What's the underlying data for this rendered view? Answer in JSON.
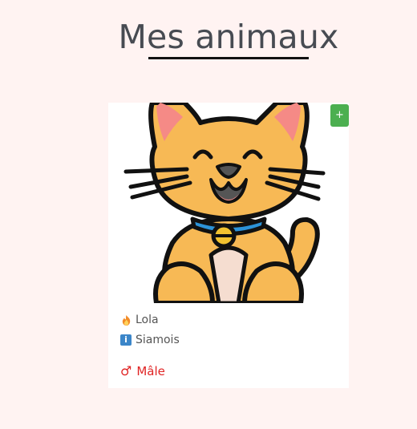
{
  "page": {
    "title": "Mes animaux"
  },
  "card": {
    "add_button_label": "+",
    "name": "Lola",
    "breed": "Siamois",
    "gender": "Mâle",
    "icons": {
      "name_icon": "fire-icon",
      "breed_icon": "info-icon",
      "gender_icon": "male-sign-icon",
      "image": "cat-illustration"
    },
    "info_glyph": "i",
    "gender_glyph": "♂"
  },
  "colors": {
    "background": "#fff3f2",
    "add_button": "#4caf50",
    "gender_text": "#e02424",
    "title_text": "#474b52"
  }
}
